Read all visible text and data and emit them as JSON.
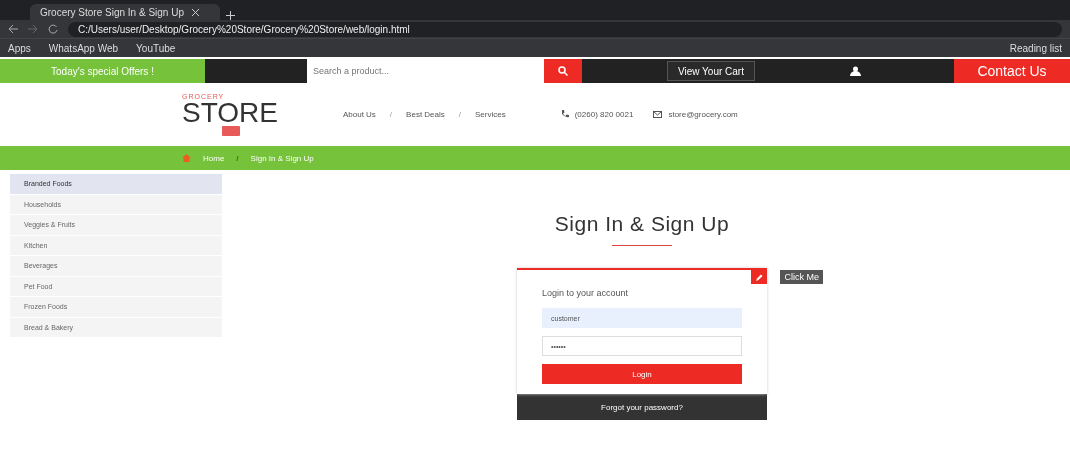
{
  "browser": {
    "tab_title": "Grocery Store Sign In & Sign Up",
    "url": "C:/Users/user/Desktop/Grocery%20Store/Grocery%20Store/web/login.html",
    "bookmarks": [
      "Apps",
      "WhatsApp Web",
      "YouTube",
      "Reading list"
    ]
  },
  "top_bar": {
    "offer": "Today's special Offers !",
    "search": {
      "placeholder": "Search a product..."
    },
    "cart": "View Your Cart",
    "contact": "Contact Us"
  },
  "header": {
    "logo_small": "GROCERY",
    "logo": "STORE",
    "nav": [
      {
        "kind": "link",
        "label": "About Us"
      },
      {
        "kind": "separator",
        "label": "/"
      },
      {
        "kind": "link",
        "label": "Best Deals"
      },
      {
        "kind": "separator",
        "label": "/"
      },
      {
        "kind": "link",
        "label": "Services"
      }
    ],
    "phone": "(0260) 820 0021",
    "email": "store@grocery.com"
  },
  "breadcrumb": [
    {
      "kind": "link",
      "label": "Home"
    },
    {
      "kind": "separator",
      "label": "/"
    },
    {
      "kind": "link",
      "label": "Sign In & Sign Up"
    }
  ],
  "sidebar": {
    "items": [
      {
        "label": "Branded Foods",
        "selected": true
      },
      {
        "label": "Households",
        "selected": false
      },
      {
        "label": "Veggies & Fruits",
        "selected": false
      },
      {
        "label": "Kitchen",
        "selected": false
      },
      {
        "label": "Beverages",
        "selected": false
      },
      {
        "label": "Pet Food",
        "selected": false
      },
      {
        "label": "Frozen Foods",
        "selected": false
      },
      {
        "label": "Bread & Bakery",
        "selected": false
      }
    ]
  },
  "login": {
    "title": "Sign In & Sign Up",
    "tooltip": "Click Me",
    "heading": "Login to your account",
    "username": "customer",
    "password": "••••••",
    "button": "Login",
    "forgot": "Forgot your password?"
  }
}
